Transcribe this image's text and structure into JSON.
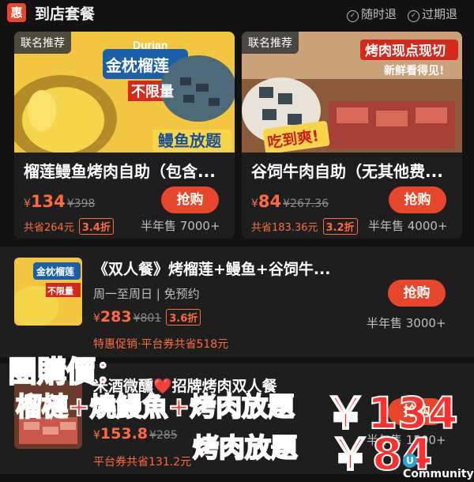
{
  "header": {
    "badge": "惠",
    "title": "到店套餐",
    "policy_anytime": "随时退",
    "policy_expired": "过期退"
  },
  "cards": [
    {
      "tag": "联名推荐",
      "img_brand": "Durian",
      "img_line1": "金枕榴莲",
      "img_line2": "不限量",
      "img_line3": "鳗鱼放题",
      "title": "榴莲鳗鱼烤肉自助（包含...",
      "currency": "¥",
      "price": "134",
      "orig": "¥398",
      "save": "共省264元",
      "discount": "3.4折",
      "sold": "半年售 7000+",
      "buy": "抢购"
    },
    {
      "tag": "联名推荐",
      "img_line1": "烤肉现点现切",
      "img_line2": "新鲜看得见!",
      "img_line3": "吃到爽!",
      "title": "谷饲牛肉自助（无其他费...",
      "currency": "¥",
      "price": "84",
      "orig": "¥267.36",
      "save": "共省183.36元",
      "discount": "3.2折",
      "sold": "半年售 4000+",
      "buy": "抢购"
    }
  ],
  "rows": [
    {
      "thumb_line1": "金枕榴莲",
      "thumb_line2": "不限量",
      "title": "《双人餐》烤榴莲+鳗鱼+谷饲牛...",
      "sub": "周一至周日 | 免预约",
      "currency": "¥",
      "price": "283",
      "orig": "¥801",
      "discount": "3.6折",
      "save": "特惠促销·平台券共省518元",
      "sold": "半年售 3000+",
      "buy": "抢购"
    },
    {
      "title": "米酒微醺❤️招牌烤肉双人餐",
      "currency": "¥",
      "price": "153.8",
      "orig": "¥285",
      "save": "平台券共省131.2元",
      "sold": "半年售 1500+",
      "buy": "抢购"
    }
  ],
  "overlay": {
    "line1": "團購價：",
    "line2": "榴槤+燒鰻魚+烤肉放題",
    "line3": "烤肉放題",
    "price1": "￥134",
    "price2": "￥84"
  },
  "watermark": "Community",
  "colors": {
    "accent": "#e8462a",
    "price": "#ff6a3d",
    "overlay_text": "#ff2f2f"
  }
}
